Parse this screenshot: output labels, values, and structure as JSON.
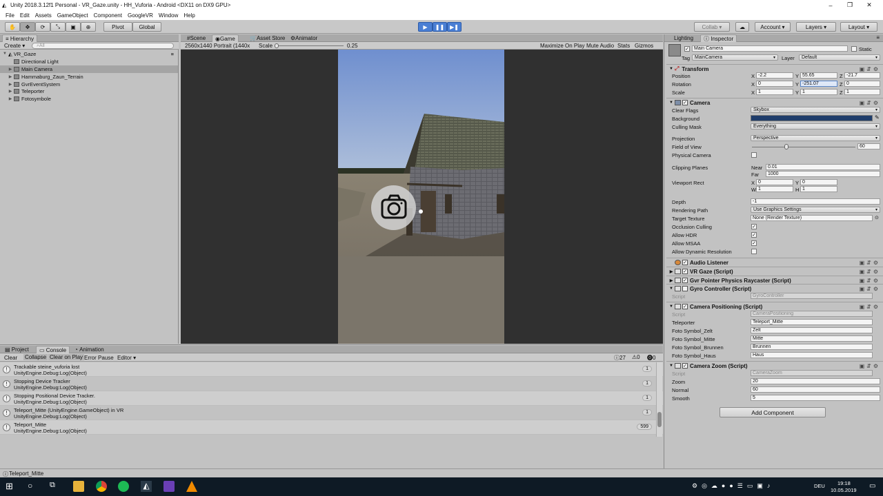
{
  "window": {
    "title": "Unity 2018.3.12f1 Personal - VR_Gaze.unity - HH_Vuforia - Android <DX11 on DX9 GPU>",
    "controls": [
      "–",
      "❐",
      "✕"
    ]
  },
  "menu": [
    "File",
    "Edit",
    "Assets",
    "GameObject",
    "Component",
    "GoogleVR",
    "Window",
    "Help"
  ],
  "toolbar": {
    "pivot": "Pivot",
    "global": "Global",
    "collab": "Collab ▾",
    "account": "Account",
    "layers": "Layers",
    "layout": "Layout"
  },
  "hierarchy": {
    "tab": "Hierarchy",
    "create": "Create",
    "search_placeholder": "All",
    "scene": "VR_Gaze",
    "items": [
      {
        "label": "Directional Light",
        "expand": ""
      },
      {
        "label": "Main Camera",
        "expand": "▶"
      },
      {
        "label": "Hammaburg_Zaun_Terrain",
        "expand": "▶"
      },
      {
        "label": "GvrEventSystem",
        "expand": "▶"
      },
      {
        "label": "Teleporter",
        "expand": "▶"
      },
      {
        "label": "Fotosymbole",
        "expand": "▶"
      }
    ]
  },
  "view_tabs": [
    "Scene",
    "Game",
    "Asset Store",
    "Animator"
  ],
  "game": {
    "resolution": "2560x1440 Portrait (1440x",
    "scale_label": "Scale",
    "scale_value": "0.25",
    "scale_fraction": 0.0,
    "opts": [
      "Maximize On Play",
      "Mute Audio",
      "Stats",
      "Gizmos"
    ]
  },
  "inspector": {
    "tabs": [
      "Lighting",
      "Inspector"
    ],
    "object_name": "Main Camera",
    "static_label": "Static",
    "tag_label": "Tag",
    "tag": "MainCamera",
    "layer_label": "Layer",
    "layer": "Default",
    "transform": {
      "title": "Transform",
      "position_label": "Position",
      "rotation_label": "Rotation",
      "scale_label": "Scale",
      "position": [
        "-2.2",
        "55.65",
        "-21.7"
      ],
      "rotation": [
        "0",
        "-251.07",
        "0"
      ],
      "scale": [
        "1",
        "1",
        "1"
      ]
    },
    "camera": {
      "title": "Camera",
      "clear_flags_label": "Clear Flags",
      "clear_flags": "Skybox",
      "background_label": "Background",
      "background_color": "#1f3d6b",
      "culling_mask_label": "Culling Mask",
      "culling_mask": "Everything",
      "projection_label": "Projection",
      "projection": "Perspective",
      "fov_label": "Field of View",
      "fov": "60",
      "fov_fraction": 0.33,
      "physical_label": "Physical Camera",
      "clipping_label": "Clipping Planes",
      "near_label": "Near",
      "near": "0.01",
      "far_label": "Far",
      "far": "1000",
      "viewport_label": "Viewport Rect",
      "vx": "0",
      "vy": "0",
      "vw": "1",
      "vh": "1",
      "depth_label": "Depth",
      "depth": "-1",
      "rendering_label": "Rendering Path",
      "rendering": "Use Graphics Settings",
      "target_label": "Target Texture",
      "target": "None (Render Texture)",
      "occlusion_label": "Occlusion Culling",
      "hdr_label": "Allow HDR",
      "msaa_label": "Allow MSAA",
      "dynres_label": "Allow Dynamic Resolution"
    },
    "components": {
      "audio": "Audio Listener",
      "vrgaze": "VR Gaze (Script)",
      "gvr": "Gvr Pointer Physics Raycaster (Script)",
      "gyro": "Gyro Controller (Script)",
      "gyro_script_label": "Script",
      "gyro_script": "GyroController",
      "campos": "Camera Positioning (Script)",
      "campos_script_label": "Script",
      "campos_script": "CameraPositioning",
      "teleporter_label": "Teleporter",
      "teleporter": "Teleport_Mitte",
      "zelt_label": "Foto Symbol_Zelt",
      "zelt": "Zelt",
      "mitte_label": "Foto Symbol_Mitte",
      "mitte": "Mitte",
      "brunnen_label": "Foto Symbol_Brunnen",
      "brunnen": "Brunnen",
      "haus_label": "Foto Symbol_Haus",
      "haus": "Haus",
      "camzoom": "Camera Zoom (Script)",
      "camzoom_script_label": "Script",
      "camzoom_script": "CameraZoom",
      "zoom_label": "Zoom",
      "zoom": "20",
      "normal_label": "Normal",
      "normal": "60",
      "smooth_label": "Smooth",
      "smooth": "5"
    },
    "add_component": "Add Component"
  },
  "console": {
    "tabs": [
      "Project",
      "Console",
      "Animation"
    ],
    "buttons": [
      "Clear",
      "Collapse",
      "Clear on Play",
      "Error Pause",
      "Editor ▾"
    ],
    "counts": {
      "log": "27",
      "warn": "0",
      "error": "0"
    },
    "entries": [
      {
        "line1": "Trackable steine_vuforia lost",
        "line2": "UnityEngine.Debug:Log(Object)",
        "count": "1"
      },
      {
        "line1": "Stopping Device Tracker",
        "line2": "UnityEngine.Debug:Log(Object)",
        "count": "1"
      },
      {
        "line1": "Stopping Positional Device Tracker.",
        "line2": "UnityEngine.Debug:Log(Object)",
        "count": "1"
      },
      {
        "line1": "Teleport_Mitte (UnityEngine.GameObject) in VR",
        "line2": "UnityEngine.Debug:Log(Object)",
        "count": "1"
      },
      {
        "line1": "Teleport_Mitte",
        "line2": "UnityEngine.Debug:Log(Object)",
        "count": "599"
      }
    ]
  },
  "statusbar": "Teleport_Mitte",
  "taskbar": {
    "lang": "DEU",
    "time": "19:18",
    "date": "10.05.2019"
  }
}
